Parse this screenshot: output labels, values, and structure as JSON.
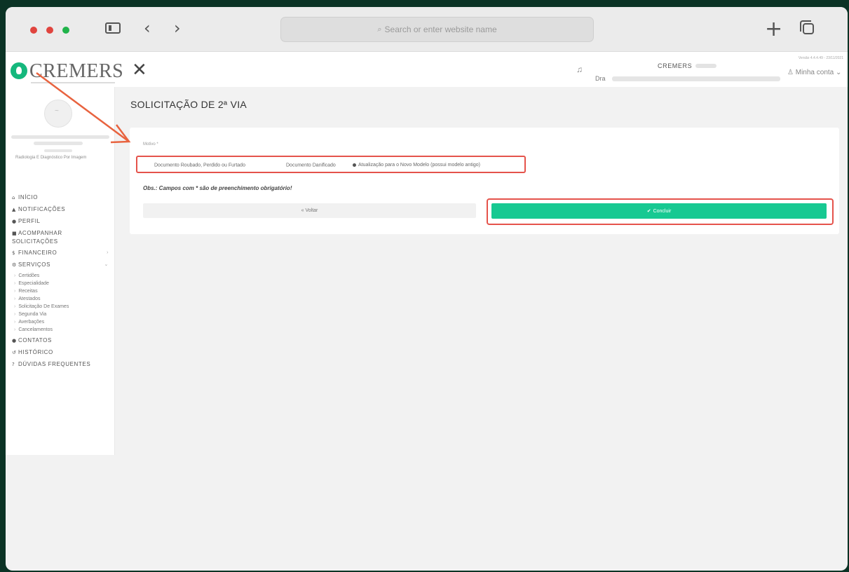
{
  "browser": {
    "address_placeholder": "Search or enter website name",
    "traffic_colors": [
      "#e0443e",
      "#e0443e",
      "#20b34a"
    ]
  },
  "app": {
    "logo_text": "CREMERS",
    "version": "Versão 4.4.4.49 - 23/11/2021",
    "org_name": "CREMERS",
    "doctor_prefix": "Dra",
    "account_label": "Minha conta"
  },
  "sidebar": {
    "specialty": "Radiologia E Diagnóstico Por Imagem",
    "items": [
      {
        "icon": "home-icon",
        "glyph": "⌂",
        "label": "INÍCIO"
      },
      {
        "icon": "bell-icon",
        "glyph": "▲",
        "label": "NOTIFICAÇÕES"
      },
      {
        "icon": "user-icon",
        "glyph": "●",
        "label": "PERFIL"
      },
      {
        "icon": "file-icon",
        "glyph": "■",
        "label": "ACOMPANHAR SOLICITAÇÕES"
      },
      {
        "icon": "dollar-icon",
        "glyph": "$",
        "label": "FINANCEIRO"
      },
      {
        "icon": "gears-icon",
        "glyph": "⚙",
        "label": "SERVIÇOS"
      }
    ],
    "sub_items": [
      "Certidões",
      "Especialidade",
      "Receitas",
      "Atestados",
      "Solicitação De Exames",
      "Segunda Via",
      "Averbações",
      "Cancelamentos"
    ],
    "bottom_items": [
      {
        "icon": "chat-icon",
        "glyph": "●",
        "label": "CONTATOS"
      },
      {
        "icon": "history-icon",
        "glyph": "↺",
        "label": "HISTÓRICO"
      },
      {
        "icon": "question-icon",
        "glyph": "?",
        "label": "DÚVIDAS FREQUENTES"
      }
    ]
  },
  "main": {
    "title": "SOLICITAÇÃO DE 2ª VIA",
    "motivo_label": "Motivo *",
    "options": [
      {
        "label": "Documento Roubado, Perdido ou Furtado",
        "selected": false
      },
      {
        "label": "Documento Danificado",
        "selected": false
      },
      {
        "label": "Atualização para o Novo Modelo (possui modelo antigo)",
        "selected": true
      }
    ],
    "obs": "Obs.: Campos com * são de preenchimento obrigatório!",
    "back_label": "« Voltar",
    "submit_label": "Concluir"
  },
  "colors": {
    "accent": "#17c992",
    "highlight": "#e5534b",
    "background": "#0b3325"
  }
}
